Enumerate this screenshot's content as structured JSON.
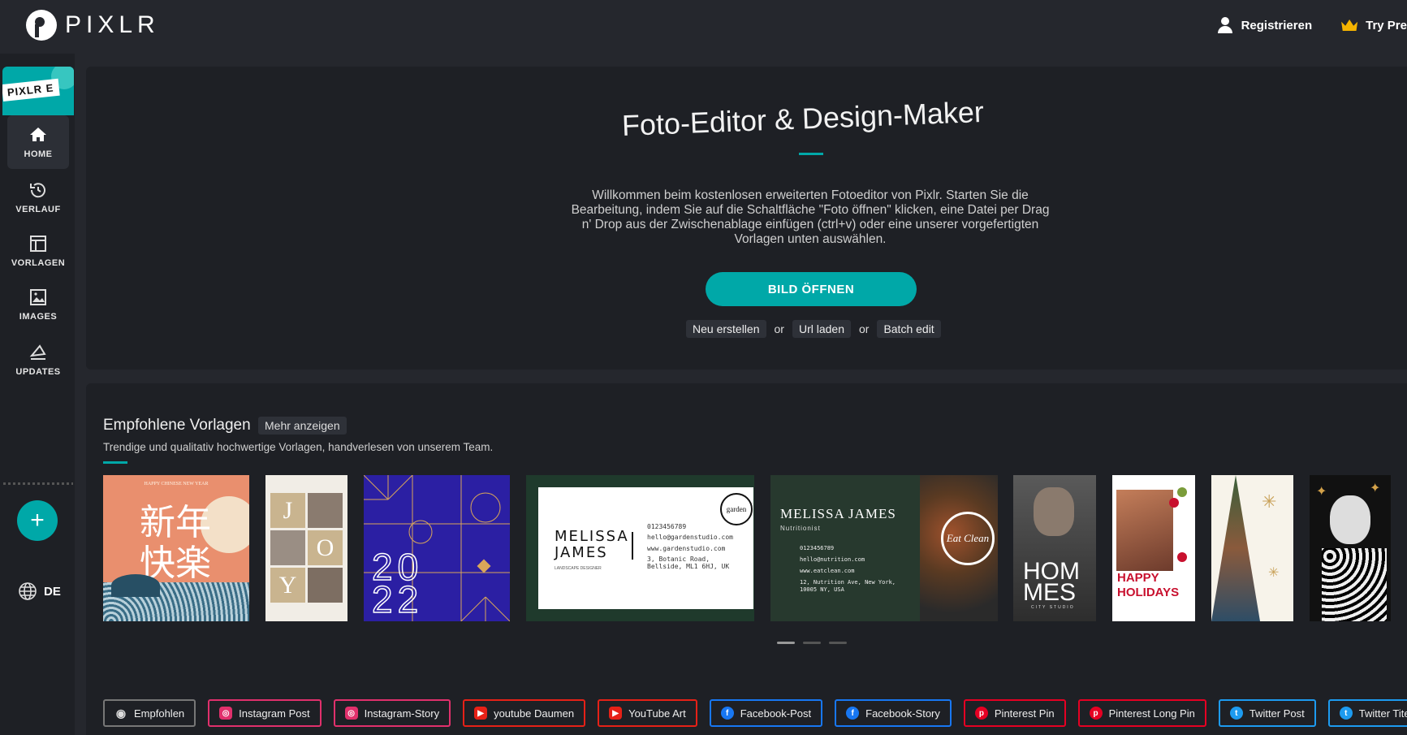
{
  "brand": {
    "logo_text": "PIXLR",
    "tile_label": "PIXLR E"
  },
  "header": {
    "register": "Registrieren",
    "premium": "Try Premium"
  },
  "sidebar": {
    "items": [
      {
        "label": "HOME"
      },
      {
        "label": "VERLAUF"
      },
      {
        "label": "VORLAGEN"
      },
      {
        "label": "IMAGES"
      },
      {
        "label": "UPDATES"
      }
    ],
    "add": "+",
    "language": "DE"
  },
  "hero": {
    "title": "Foto-Editor & Design-Maker",
    "description": "Willkommen beim kostenlosen erweiterten Fotoeditor von Pixlr. Starten Sie die Bearbeitung, indem Sie auf die Schaltfläche \"Foto öffnen\" klicken, eine Datei per Drag n' Drop aus der Zwischenablage einfügen (ctrl+v) oder eine unserer vorgefertigten Vorlagen unten auswählen.",
    "open_button": "BILD ÖFFNEN",
    "new_label": "Neu erstellen",
    "or1": "or",
    "url_label": "Url laden",
    "or2": "or",
    "batch_label": "Batch edit"
  },
  "templates": {
    "title": "Empfohlene Vorlagen",
    "more": "Mehr anzeigen",
    "subtitle": "Trendige und qualitativ hochwertige Vorlagen, handverlesen von unserem Team.",
    "cards": {
      "cny_small": "HAPPY CHINESE NEW YEAR",
      "cny_chars1": "新年",
      "cny_chars2": "快楽",
      "joy_j": "J",
      "joy_o": "O",
      "joy_y": "Y",
      "year_top": "20",
      "year_bottom": "22",
      "bc1_name1": "MELISSA",
      "bc1_name2": "JAMES",
      "bc1_role": "LANDSCAPE DESIGNER",
      "bc1_phone": "0123456789",
      "bc1_mail": "hello@gardenstudio.com",
      "bc1_web": "www.gardenstudio.com",
      "bc1_addr": "3, Botanic Road, Bellside, ML1 6HJ, UK",
      "bc1_logo": "garden",
      "bc2_name": "MELISSA JAMES",
      "bc2_role": "Nutritionist",
      "bc2_phone": "0123456789",
      "bc2_mail": "hello@nutrition.com",
      "bc2_web": "www.eatclean.com",
      "bc2_addr": "12, Nutrition Ave, New York, 10005 NY, USA",
      "bc2_logo": "Eat Clean",
      "homes1": "HOM",
      "homes2": "MES",
      "homes_sub": "CITY STUDIO",
      "holidays1": "HAPPY",
      "holidays2": "HOLIDAYS"
    }
  },
  "categories": [
    {
      "label": "Empfohlen",
      "icon": "eye-icon",
      "color": "#cccccc"
    },
    {
      "label": "Instagram Post",
      "icon": "instagram-icon",
      "color": "#e1306c"
    },
    {
      "label": "Instagram-Story",
      "icon": "instagram-icon",
      "color": "#e1306c"
    },
    {
      "label": "youtube Daumen",
      "icon": "youtube-icon",
      "color": "#e62117"
    },
    {
      "label": "YouTube Art",
      "icon": "youtube-icon",
      "color": "#e62117"
    },
    {
      "label": "Facebook-Post",
      "icon": "facebook-icon",
      "color": "#1877f2"
    },
    {
      "label": "Facebook-Story",
      "icon": "facebook-icon",
      "color": "#1877f2"
    },
    {
      "label": "Pinterest Pin",
      "icon": "pinterest-icon",
      "color": "#e60023"
    },
    {
      "label": "Pinterest Long Pin",
      "icon": "pinterest-icon",
      "color": "#e60023"
    },
    {
      "label": "Twitter Post",
      "icon": "twitter-icon",
      "color": "#1d9bf0"
    },
    {
      "label": "Twitter Titelbild",
      "icon": "twitter-icon",
      "color": "#1d9bf0"
    }
  ],
  "colors": {
    "accent": "#00a8a8",
    "background": "#25272d",
    "panel": "#1e2025"
  }
}
